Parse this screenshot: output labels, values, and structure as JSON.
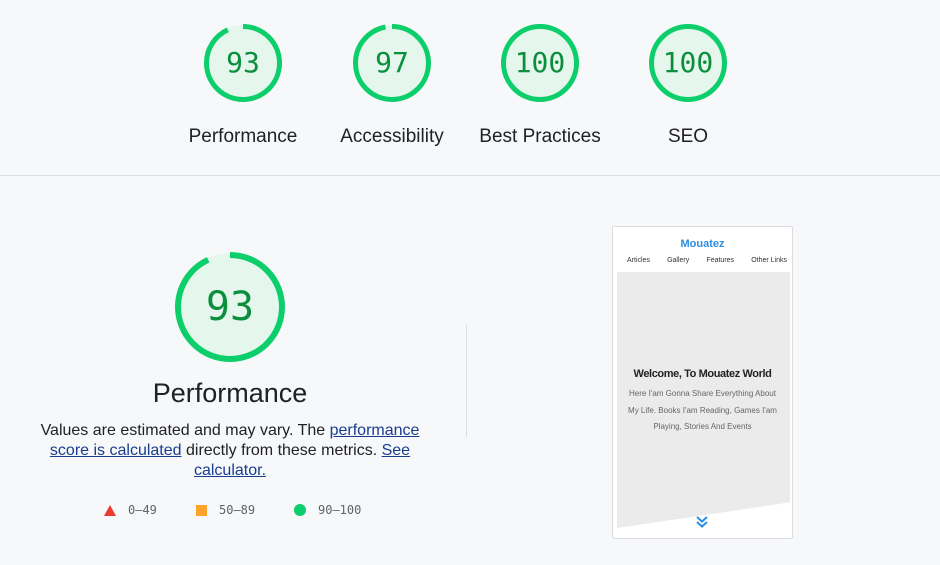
{
  "categories": [
    {
      "score": "93",
      "label": "Performance"
    },
    {
      "score": "97",
      "label": "Accessibility"
    },
    {
      "score": "100",
      "label": "Best Practices"
    },
    {
      "score": "100",
      "label": "SEO"
    }
  ],
  "performance": {
    "score": "93",
    "title": "Performance",
    "desc_1": "Values are estimated and may vary. The ",
    "link_calc": "performance score is calculated",
    "desc_2": " directly from these metrics. ",
    "link_see": "See calculator."
  },
  "legend": {
    "fail": "0–49",
    "average": "50–89",
    "pass": "90–100"
  },
  "screenshot": {
    "brand": "Mouatez",
    "nav": [
      "Articles",
      "Gallery",
      "Features",
      "Other Links"
    ],
    "heading": "Welcome, To Mouatez World",
    "subtext": "Here I'am Gonna Share Everything About My Life. Books I'am Reading, Games I'am Playing, Stories And Events"
  },
  "colors": {
    "pass_green": "#0cce6b",
    "pass_text": "#0a8f3c",
    "gauge_bg": "#e5f7ec",
    "fail_red": "#eb3b2f",
    "average_orange": "#ffa32a",
    "link": "#1a3c8f"
  }
}
